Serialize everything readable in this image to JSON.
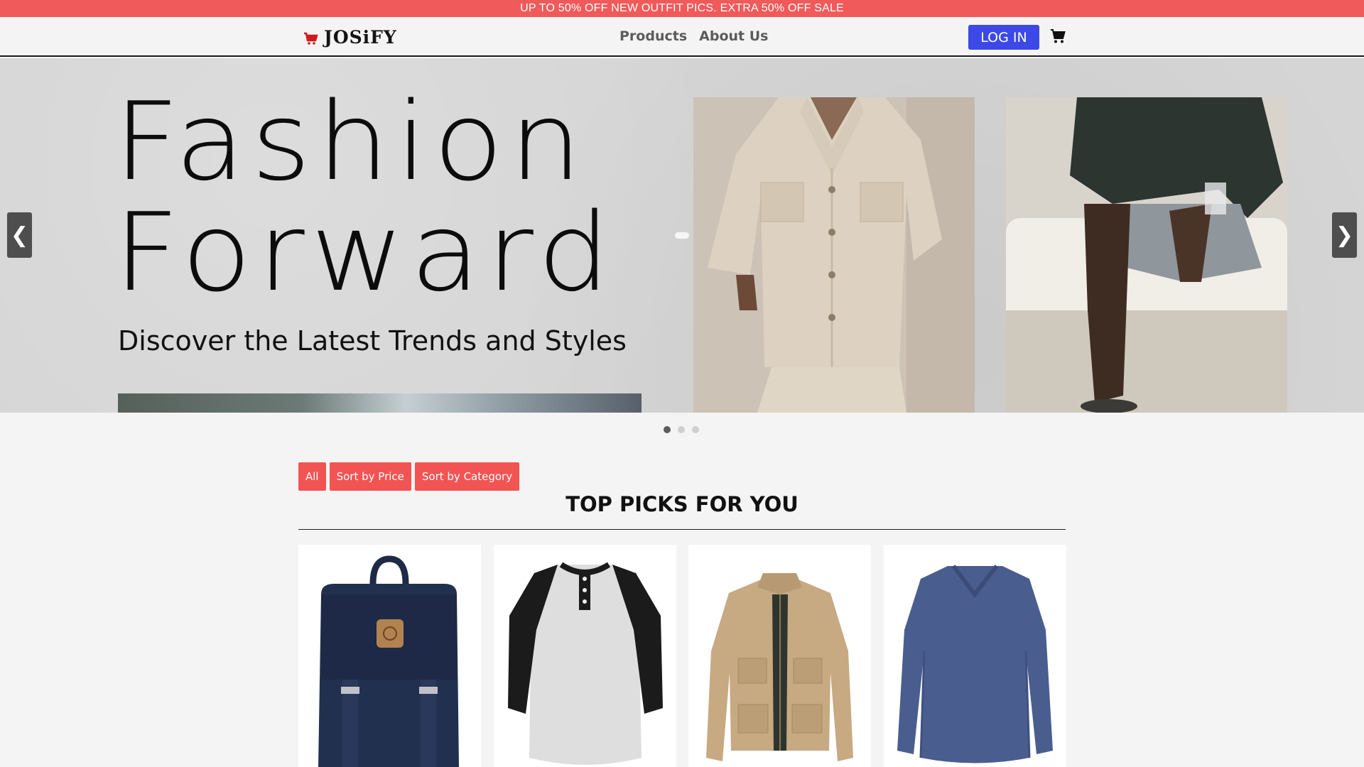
{
  "promo": {
    "text": "UP TO 50% OFF NEW OUTFIT PICS.  EXTRA 50% OFF SALE"
  },
  "header": {
    "logo": "JOSiFY",
    "nav": [
      "Products",
      "About Us"
    ],
    "login_label": "LOG IN"
  },
  "hero": {
    "title_line1": "Fashion",
    "title_line2": "Forward",
    "subtitle": "Discover the Latest Trends and Styles",
    "prev_arrow": "❮",
    "next_arrow": "❯",
    "slide_count": 3,
    "active_slide": 1
  },
  "filters": [
    "All",
    "Sort by Price",
    "Sort by Category"
  ],
  "section": {
    "title": "TOP PICKS FOR YOU"
  },
  "products": [
    {
      "icon": "backpack-image"
    },
    {
      "icon": "raglan-shirt-image"
    },
    {
      "icon": "jacket-image"
    },
    {
      "icon": "sweater-image"
    }
  ],
  "colors": {
    "promo_bg": "#f05a5a",
    "login_bg": "#3d49e6",
    "sort_bg": "#f25454",
    "page_bg": "#f4f4f4"
  }
}
